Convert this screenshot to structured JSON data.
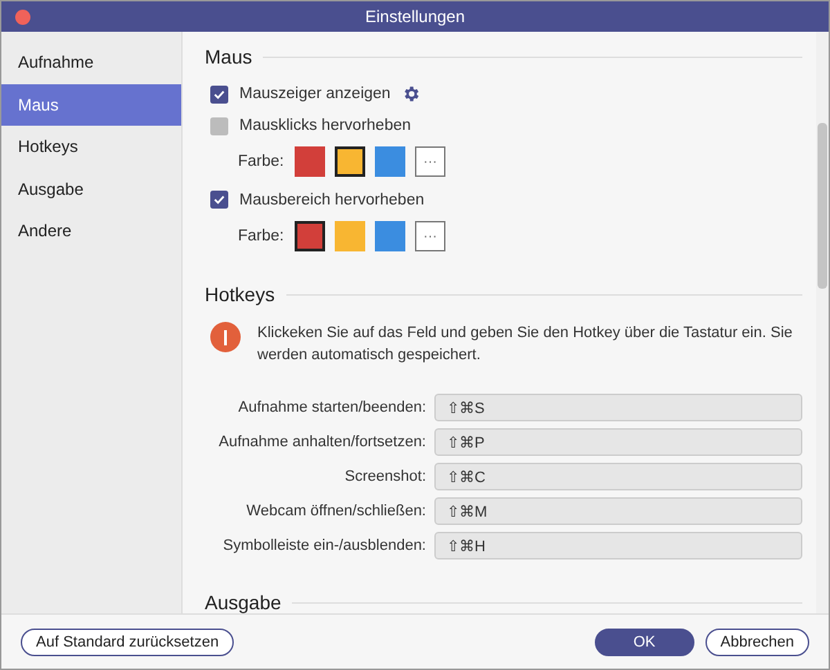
{
  "window": {
    "title": "Einstellungen"
  },
  "sidebar": {
    "items": [
      {
        "label": "Aufnahme",
        "selected": false
      },
      {
        "label": "Maus",
        "selected": true
      },
      {
        "label": "Hotkeys",
        "selected": false
      },
      {
        "label": "Ausgabe",
        "selected": false
      },
      {
        "label": "Andere",
        "selected": false
      }
    ]
  },
  "mouse": {
    "heading": "Maus",
    "options": [
      {
        "label": "Mauszeiger anzeigen",
        "checked": true,
        "settings": true
      },
      {
        "label": "Mausklicks hervorheben",
        "checked": false,
        "color_label": "Farbe:",
        "swatches": [
          {
            "color": "#d23f3a",
            "selected": false
          },
          {
            "color": "#f8b632",
            "selected": true
          },
          {
            "color": "#3b8de0",
            "selected": false
          }
        ],
        "more": "···"
      },
      {
        "label": "Mausbereich hervorheben",
        "checked": true,
        "color_label": "Farbe:",
        "swatches": [
          {
            "color": "#d23f3a",
            "selected": true
          },
          {
            "color": "#f8b632",
            "selected": false
          },
          {
            "color": "#3b8de0",
            "selected": false
          }
        ],
        "more": "···"
      }
    ]
  },
  "hotkeys": {
    "heading": "Hotkeys",
    "info": "Klickeken Sie auf das Feld und geben Sie den Hotkey über die Tastatur ein. Sie werden automatisch gespeichert.",
    "rows": [
      {
        "label": "Aufnahme starten/beenden:",
        "value": "⇧⌘S"
      },
      {
        "label": "Aufnahme anhalten/fortsetzen:",
        "value": "⇧⌘P"
      },
      {
        "label": "Screenshot:",
        "value": "⇧⌘C"
      },
      {
        "label": "Webcam öffnen/schließen:",
        "value": "⇧⌘M"
      },
      {
        "label": "Symbolleiste ein-/ausblenden:",
        "value": "⇧⌘H"
      }
    ]
  },
  "output": {
    "heading": "Ausgabe"
  },
  "footer": {
    "reset": "Auf Standard zurücksetzen",
    "ok": "OK",
    "cancel": "Abbrechen"
  }
}
